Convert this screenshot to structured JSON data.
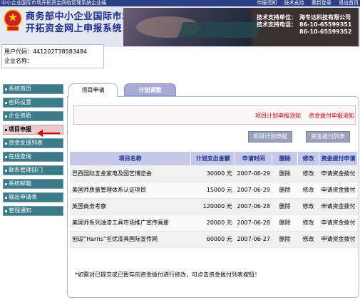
{
  "topbar": {
    "title": "中小企业国际市场开拓资金网络管理系统企业端",
    "links": [
      "申报须知",
      "技术支持",
      "重新登录",
      "退出首页"
    ]
  },
  "header": {
    "title_line1": "商务部中小企业国际市场",
    "title_line2": "开拓资金网上申报系统",
    "support_unit_label": "技术支持单位：",
    "support_unit_value": "海专达科技有限公司",
    "support_phone_label": "技术支持电话：",
    "support_phone_1": "86-10-65599351",
    "support_phone_2": "86-10-65599352"
  },
  "user": {
    "code_label": "用户代码：",
    "code_value": "441202T38583484",
    "company_label": "企业名称：",
    "company_value": ""
  },
  "menu": {
    "items": [
      {
        "label": "系统首页",
        "active": false
      },
      {
        "label": "密码设置",
        "active": false
      },
      {
        "label": "企业资质",
        "active": false
      },
      {
        "label": "项目申报",
        "active": true
      },
      {
        "label": "资金反馈列表",
        "active": false
      },
      {
        "label": "在线查询",
        "active": false
      },
      {
        "label": "联系管理部门",
        "active": false
      },
      {
        "label": "系统邮箱",
        "active": false
      },
      {
        "label": "输出申请表",
        "active": false
      },
      {
        "label": "管理通知",
        "active": false
      }
    ]
  },
  "tabs": {
    "tab1": "项目申请",
    "tab2": "计划调整"
  },
  "links": {
    "plan_notice": "项目计划申报须知",
    "fund_notice": "资金拨付申报须知"
  },
  "buttons": {
    "plan": "项目计划申报",
    "list": "资金拨付列表"
  },
  "table": {
    "headers": [
      "项目名称",
      "计划支出金额",
      "申请时间",
      "删除",
      "修改",
      "资金拨付申请"
    ],
    "unit": "元",
    "rows": [
      {
        "name": "巴西国际五金家电及园艺博览会",
        "amount": "30000",
        "date": "2007-06-29",
        "del": "删除",
        "edit": "修改",
        "apply": "申请资金拨付"
      },
      {
        "name": "美国师质量管理体系认证项目",
        "amount": "15000",
        "date": "2007-06-29",
        "del": "删除",
        "edit": "修改",
        "apply": "申请资金拨付"
      },
      {
        "name": "英国商务考察",
        "amount": "120000",
        "date": "2007-06-28",
        "del": "删除",
        "edit": "修改",
        "apply": "申请资金拨付"
      },
      {
        "name": "美国师系列油漆工具市场推广宣传画册",
        "amount": "20000",
        "date": "2007-06-28",
        "del": "删除",
        "edit": "修改",
        "apply": "申请资金拨付"
      },
      {
        "name": "创设“Harris”名优漆具国际宣传网",
        "amount": "60000",
        "date": "2007-06-27",
        "del": "删除",
        "edit": "修改",
        "apply": "申请资金拨付"
      }
    ]
  },
  "note": "*如需对已提交或已暂存的资金拨付进行修改，可点击资金拨付列表按钮！",
  "colors": {
    "menu_bg": "#3c7b8a",
    "menu_active_bg": "#e7c9cf",
    "table_header_bg": "#c6c8ea",
    "link_red": "#d40000",
    "title_blue": "#1a2d8a"
  }
}
